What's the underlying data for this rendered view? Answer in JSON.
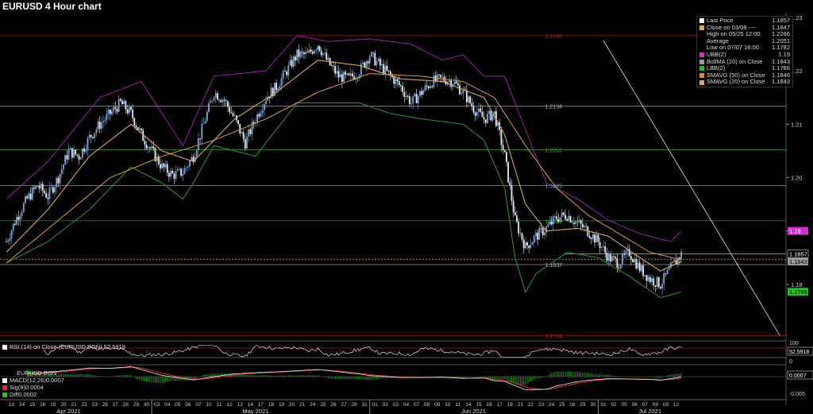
{
  "title": "EURUSD 4 Hour chart",
  "colors": {
    "up": "#7fa6d6",
    "down": "#e8eef7",
    "bb_outer": "#9b1fa8",
    "bb_lower": "#2f9a2f",
    "sma50": "#c98f4a",
    "sma20": "#d8a766",
    "trend": "#d0d0d0",
    "rsi": "#e0e0e0",
    "hline_red": "#b02020",
    "hline_cyan": "#4fb5c8",
    "hline_green": "#38a838",
    "hline_gray": "#b8b8b8",
    "last_price": "#e8d8b0",
    "macd_up": "#2e9a2e",
    "macd_red": "#c83030",
    "macd_white": "#e8e8e8"
  },
  "legend": [
    {
      "label": "Last Price",
      "value": "1.1857",
      "color": "#ffffff"
    },
    {
      "label": "Close on 03/08 ----",
      "value": "1.1847",
      "color": "#d8a766"
    },
    {
      "label": "High on 05/25 12:00",
      "value": "1.2266",
      "color": "#000000"
    },
    {
      "label": "Average",
      "value": "1.2051",
      "color": "#000000"
    },
    {
      "label": "Low on 07/07 16:00",
      "value": "1.1782",
      "color": "#000000"
    },
    {
      "label": "UBB(2)",
      "value": "1.19",
      "color": "#cc33cc"
    },
    {
      "label": "BollMA (20)  on Close",
      "value": "1.1843",
      "color": "#999999"
    },
    {
      "label": "LBB(2)",
      "value": "1.1786",
      "color": "#2eb82e"
    },
    {
      "label": "SMAVG (50)  on Close",
      "value": "1.1846",
      "color": "#c98f4a"
    },
    {
      "label": "SMAVG (20)  on Close",
      "value": "1.1843",
      "color": "#d8a766"
    }
  ],
  "rsi_legend": "RSI (14)  on Close (EURUSD BGN)  52.5918",
  "macd_legend": {
    "name": "EURUSD BGN",
    "rows": [
      {
        "label": "MACD(12,26)",
        "value": "0.0007",
        "color": "#ffffff"
      },
      {
        "label": "Sig(9)",
        "value": "0.0004",
        "color": "#d03030"
      },
      {
        "label": "Diff",
        "value": "0.0002",
        "color": "#2eb82e"
      }
    ]
  },
  "chart_data": {
    "type": "candlestick",
    "title": "EURUSD 4 Hour chart",
    "ylim": [
      1.17,
      1.23
    ],
    "y_ticks": [
      1.18,
      1.19,
      1.2,
      1.21,
      1.22,
      1.23
    ],
    "x_day_labels": [
      "13",
      "14",
      "15",
      "16",
      "19",
      "20",
      "21",
      "22",
      "23",
      "26",
      "27",
      "28",
      "29",
      "30",
      "03",
      "04",
      "05",
      "06",
      "07",
      "10",
      "11",
      "12",
      "13",
      "14",
      "17",
      "18",
      "19",
      "20",
      "21",
      "24",
      "25",
      "26",
      "27",
      "28",
      "31",
      "01",
      "02",
      "03",
      "04",
      "07",
      "08",
      "09",
      "10",
      "11",
      "14",
      "15",
      "16",
      "17",
      "18",
      "21",
      "22",
      "23",
      "24",
      "25",
      "28",
      "29",
      "30",
      "01",
      "02",
      "05",
      "06",
      "07",
      "08",
      "09",
      "12"
    ],
    "x_month_labels": [
      {
        "label": "Apr 2021",
        "day_index": 6
      },
      {
        "label": "May 2021",
        "day_index": 24
      },
      {
        "label": "Jun 2021",
        "day_index": 45
      },
      {
        "label": "Jul 2021",
        "day_index": 62
      }
    ],
    "month_separators": [
      14,
      35,
      57
    ],
    "horizontal_levels": [
      {
        "value": 1.2266,
        "label": "1.2266",
        "kind": "red"
      },
      {
        "value": 1.2134,
        "label": "1.2134",
        "kind": "gray"
      },
      {
        "value": 1.2052,
        "label": "1.2052",
        "kind": "green"
      },
      {
        "value": 1.1985,
        "label": "1.1985",
        "kind": "cyan"
      },
      {
        "value": 1.1919,
        "label": "1.1919",
        "kind": "green"
      },
      {
        "value": 1.1837,
        "label": "1.1837",
        "kind": "gray"
      },
      {
        "value": 1.1704,
        "label": "1.1704",
        "kind": "red"
      }
    ],
    "right_tags": [
      {
        "value": 1.19,
        "label": "1.19",
        "bg": "#cc33cc",
        "fg": "#ffffff"
      },
      {
        "value": 1.1857,
        "label": "1.1857",
        "bg": "#000000",
        "fg": "#ffffff",
        "border": "#cccccc"
      },
      {
        "value": 1.1843,
        "label": "1.1843",
        "bg": "#9a9a9a",
        "fg": "#000000"
      },
      {
        "value": 1.1786,
        "label": "1.1786",
        "bg": "#2eb82e",
        "fg": "#000000"
      }
    ],
    "close_line": 1.1847,
    "last_line": 1.1857,
    "trendline": [
      {
        "day": 57.5,
        "value": 1.2257
      },
      {
        "day": 74.5,
        "value": 1.1704
      }
    ],
    "price_keypoints": [
      [
        0,
        1.188
      ],
      [
        1,
        1.1925
      ],
      [
        2,
        1.196
      ],
      [
        3,
        1.1985
      ],
      [
        4,
        1.1965
      ],
      [
        5,
        1.2
      ],
      [
        6,
        1.205
      ],
      [
        7,
        1.204
      ],
      [
        8,
        1.2075
      ],
      [
        9,
        1.21
      ],
      [
        10,
        1.212
      ],
      [
        11,
        1.214
      ],
      [
        12,
        1.212
      ],
      [
        13,
        1.208
      ],
      [
        14,
        1.205
      ],
      [
        15,
        1.202
      ],
      [
        16,
        1.2005
      ],
      [
        17,
        1.201
      ],
      [
        18,
        1.204
      ],
      [
        19,
        1.21
      ],
      [
        20,
        1.216
      ],
      [
        21,
        1.2145
      ],
      [
        22,
        1.211
      ],
      [
        23,
        1.2065
      ],
      [
        24,
        1.211
      ],
      [
        25,
        1.215
      ],
      [
        26,
        1.217
      ],
      [
        27,
        1.22
      ],
      [
        28,
        1.223
      ],
      [
        29,
        1.223
      ],
      [
        30,
        1.225
      ],
      [
        31,
        1.2215
      ],
      [
        32,
        1.219
      ],
      [
        33,
        1.2185
      ],
      [
        34,
        1.22
      ],
      [
        35,
        1.223
      ],
      [
        36,
        1.221
      ],
      [
        37,
        1.219
      ],
      [
        38,
        1.217
      ],
      [
        39,
        1.214
      ],
      [
        40,
        1.216
      ],
      [
        41,
        1.218
      ],
      [
        42,
        1.2185
      ],
      [
        43,
        1.218
      ],
      [
        44,
        1.216
      ],
      [
        45,
        1.213
      ],
      [
        46,
        1.211
      ],
      [
        47,
        1.212
      ],
      [
        48,
        1.204
      ],
      [
        49,
        1.192
      ],
      [
        50,
        1.187
      ],
      [
        51,
        1.189
      ],
      [
        52,
        1.1905
      ],
      [
        53,
        1.1925
      ],
      [
        54,
        1.193
      ],
      [
        55,
        1.1915
      ],
      [
        56,
        1.19
      ],
      [
        57,
        1.188
      ],
      [
        58,
        1.185
      ],
      [
        59,
        1.184
      ],
      [
        60,
        1.186
      ],
      [
        61,
        1.183
      ],
      [
        62,
        1.181
      ],
      [
        63,
        1.18
      ],
      [
        64,
        1.183
      ],
      [
        65,
        1.1857
      ]
    ],
    "ubb_keypoints": [
      [
        0,
        1.196
      ],
      [
        4,
        1.203
      ],
      [
        9,
        1.215
      ],
      [
        13,
        1.218
      ],
      [
        17,
        1.206
      ],
      [
        20,
        1.219
      ],
      [
        25,
        1.22
      ],
      [
        28,
        1.2266
      ],
      [
        31,
        1.2255
      ],
      [
        35,
        1.226
      ],
      [
        39,
        1.225
      ],
      [
        42,
        1.222
      ],
      [
        44,
        1.223
      ],
      [
        46,
        1.219
      ],
      [
        48,
        1.219
      ],
      [
        50,
        1.209
      ],
      [
        52,
        1.199
      ],
      [
        55,
        1.196
      ],
      [
        58,
        1.192
      ],
      [
        61,
        1.1895
      ],
      [
        64,
        1.188
      ],
      [
        65,
        1.19
      ]
    ],
    "lbb_keypoints": [
      [
        0,
        1.184
      ],
      [
        4,
        1.188
      ],
      [
        8,
        1.194
      ],
      [
        12,
        1.202
      ],
      [
        15,
        1.199
      ],
      [
        17,
        1.196
      ],
      [
        18,
        1.199
      ],
      [
        20,
        1.206
      ],
      [
        24,
        1.204
      ],
      [
        28,
        1.214
      ],
      [
        31,
        1.214
      ],
      [
        34,
        1.214
      ],
      [
        37,
        1.212
      ],
      [
        40,
        1.211
      ],
      [
        44,
        1.21
      ],
      [
        46,
        1.207
      ],
      [
        48,
        1.198
      ],
      [
        49,
        1.185
      ],
      [
        50,
        1.1785
      ],
      [
        51,
        1.182
      ],
      [
        54,
        1.186
      ],
      [
        57,
        1.185
      ],
      [
        60,
        1.1815
      ],
      [
        63,
        1.1775
      ],
      [
        65,
        1.1786
      ]
    ],
    "sma50_keypoints": [
      [
        0,
        1.184
      ],
      [
        5,
        1.192
      ],
      [
        10,
        1.2
      ],
      [
        15,
        1.204
      ],
      [
        20,
        1.207
      ],
      [
        25,
        1.211
      ],
      [
        30,
        1.216
      ],
      [
        35,
        1.2195
      ],
      [
        40,
        1.219
      ],
      [
        44,
        1.218
      ],
      [
        47,
        1.215
      ],
      [
        50,
        1.206
      ],
      [
        53,
        1.198
      ],
      [
        56,
        1.193
      ],
      [
        59,
        1.1895
      ],
      [
        62,
        1.186
      ],
      [
        65,
        1.1846
      ]
    ],
    "sma20_keypoints": [
      [
        0,
        1.186
      ],
      [
        4,
        1.194
      ],
      [
        8,
        1.204
      ],
      [
        12,
        1.21
      ],
      [
        15,
        1.205
      ],
      [
        18,
        1.203
      ],
      [
        22,
        1.211
      ],
      [
        26,
        1.216
      ],
      [
        30,
        1.222
      ],
      [
        34,
        1.221
      ],
      [
        38,
        1.2185
      ],
      [
        42,
        1.218
      ],
      [
        46,
        1.215
      ],
      [
        48,
        1.208
      ],
      [
        50,
        1.195
      ],
      [
        52,
        1.19
      ],
      [
        55,
        1.1905
      ],
      [
        58,
        1.189
      ],
      [
        61,
        1.185
      ],
      [
        63,
        1.1825
      ],
      [
        65,
        1.1843
      ]
    ],
    "rsi": {
      "label": "RSI (14)  on Close (EURUSD BGN)",
      "last": 52.5918,
      "ylim": [
        0,
        100
      ],
      "levels": [
        70,
        30
      ],
      "ticks": [
        100,
        0
      ]
    },
    "macd": {
      "macd": 0.0007,
      "signal": 0.0004,
      "diff": 0.0002,
      "ticks": [
        0.0007,
        -0.005
      ]
    }
  }
}
